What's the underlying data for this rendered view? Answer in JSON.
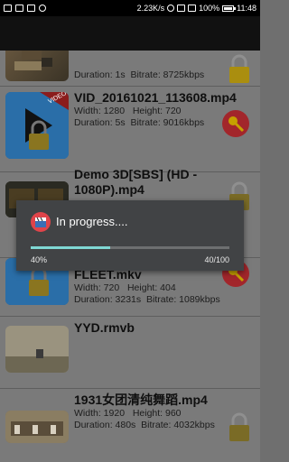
{
  "status_bar": {
    "speed": "2.23K/s",
    "battery": "100%",
    "time": "11:48"
  },
  "videos": [
    {
      "name": "",
      "width_label": "",
      "duration": "Duration: 1s",
      "bitrate": "Bitrate: 8725kbps",
      "locked": true,
      "badge": "lock"
    },
    {
      "name": "VID_20161021_113608.mp4",
      "width_label": "Width: 1280",
      "height_label": "Height: 720",
      "duration": "Duration: 5s",
      "bitrate": "Bitrate: 9016kbps",
      "badge": "key"
    },
    {
      "name": "Demo 3D[SBS] (HD - 1080P).mp4",
      "badge": "lock"
    },
    {
      "name": "FLEET.mkv",
      "width_label": "Width: 720",
      "height_label": "Height: 404",
      "duration": "Duration: 3231s",
      "bitrate": "Bitrate: 1089kbps",
      "badge": "key"
    },
    {
      "name": "YYD.rmvb",
      "badge": "none"
    },
    {
      "name": "1931女团清纯舞蹈.mp4",
      "width_label": "Width: 1920",
      "height_label": "Height: 960",
      "duration": "Duration: 480s",
      "bitrate": "Bitrate: 4032kbps",
      "badge": "lock"
    }
  ],
  "dialog": {
    "title": "In progress....",
    "percent_label": "40%",
    "count_label": "40/100",
    "progress_fraction": 0.4
  },
  "colors": {
    "progress_accent": "#7fd8d4",
    "dialog_bg": "#414345",
    "lock_gold": "#e8b400",
    "key_red": "#a2262b"
  },
  "icons": {
    "lock": "padlock-icon",
    "key": "key-icon",
    "dialog": "film-clapper-icon"
  }
}
